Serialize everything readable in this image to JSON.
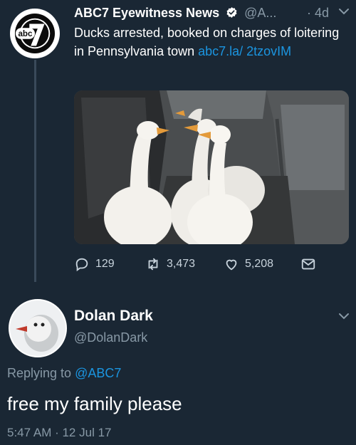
{
  "tweet": {
    "author_name": "ABC7 Eyewitness News",
    "author_handle": "@A...",
    "time_sep": "·",
    "age": "4d",
    "text": "Ducks arrested, booked on charges of loitering in Pennsylvania town ",
    "link_text": "abc7.la/ 2tzovIM",
    "avatar_text": "abc",
    "stats": {
      "replies": "129",
      "retweets": "3,473",
      "likes": "5,208"
    },
    "icons": [
      "reply-icon",
      "retweet-icon",
      "like-icon",
      "message-icon",
      "chevron-down-icon",
      "verified-badge-icon"
    ]
  },
  "reply": {
    "author_name": "Dolan Dark",
    "author_handle": "@DolanDark",
    "replying_prefix": "Replying to ",
    "replying_handle": "@ABC7",
    "text": "free my family please",
    "timestamp": "5:47 AM · 12 Jul 17"
  },
  "colors": {
    "background": "#1a2734",
    "link": "#1b95e0",
    "muted": "#8899a6",
    "abc_black": "#000000"
  }
}
